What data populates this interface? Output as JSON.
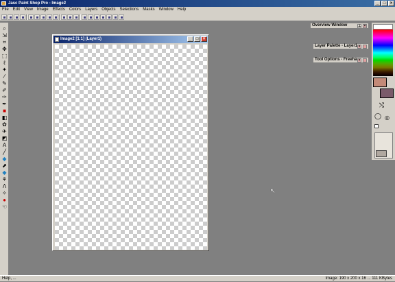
{
  "app": {
    "title": "Jasc Paint Shop Pro - Image2"
  },
  "menu": [
    "File",
    "Edit",
    "View",
    "Image",
    "Effects",
    "Colors",
    "Layers",
    "Objects",
    "Selections",
    "Masks",
    "Window",
    "Help"
  ],
  "image_window": {
    "title": "Image2 [1:1] (Layer1)"
  },
  "palettes": {
    "overview": "Overview Window",
    "layer": "Layer Palette - Layer1",
    "tool_options": "Tool Options - Freeha"
  },
  "colors": {
    "foreground": "#c38a78",
    "background": "#7a5a6a",
    "accent": "#0a246a"
  },
  "statusbar": {
    "left": "Help, ...",
    "right": "Image: 190 x 200 x 16 ... 111 KBytes"
  }
}
